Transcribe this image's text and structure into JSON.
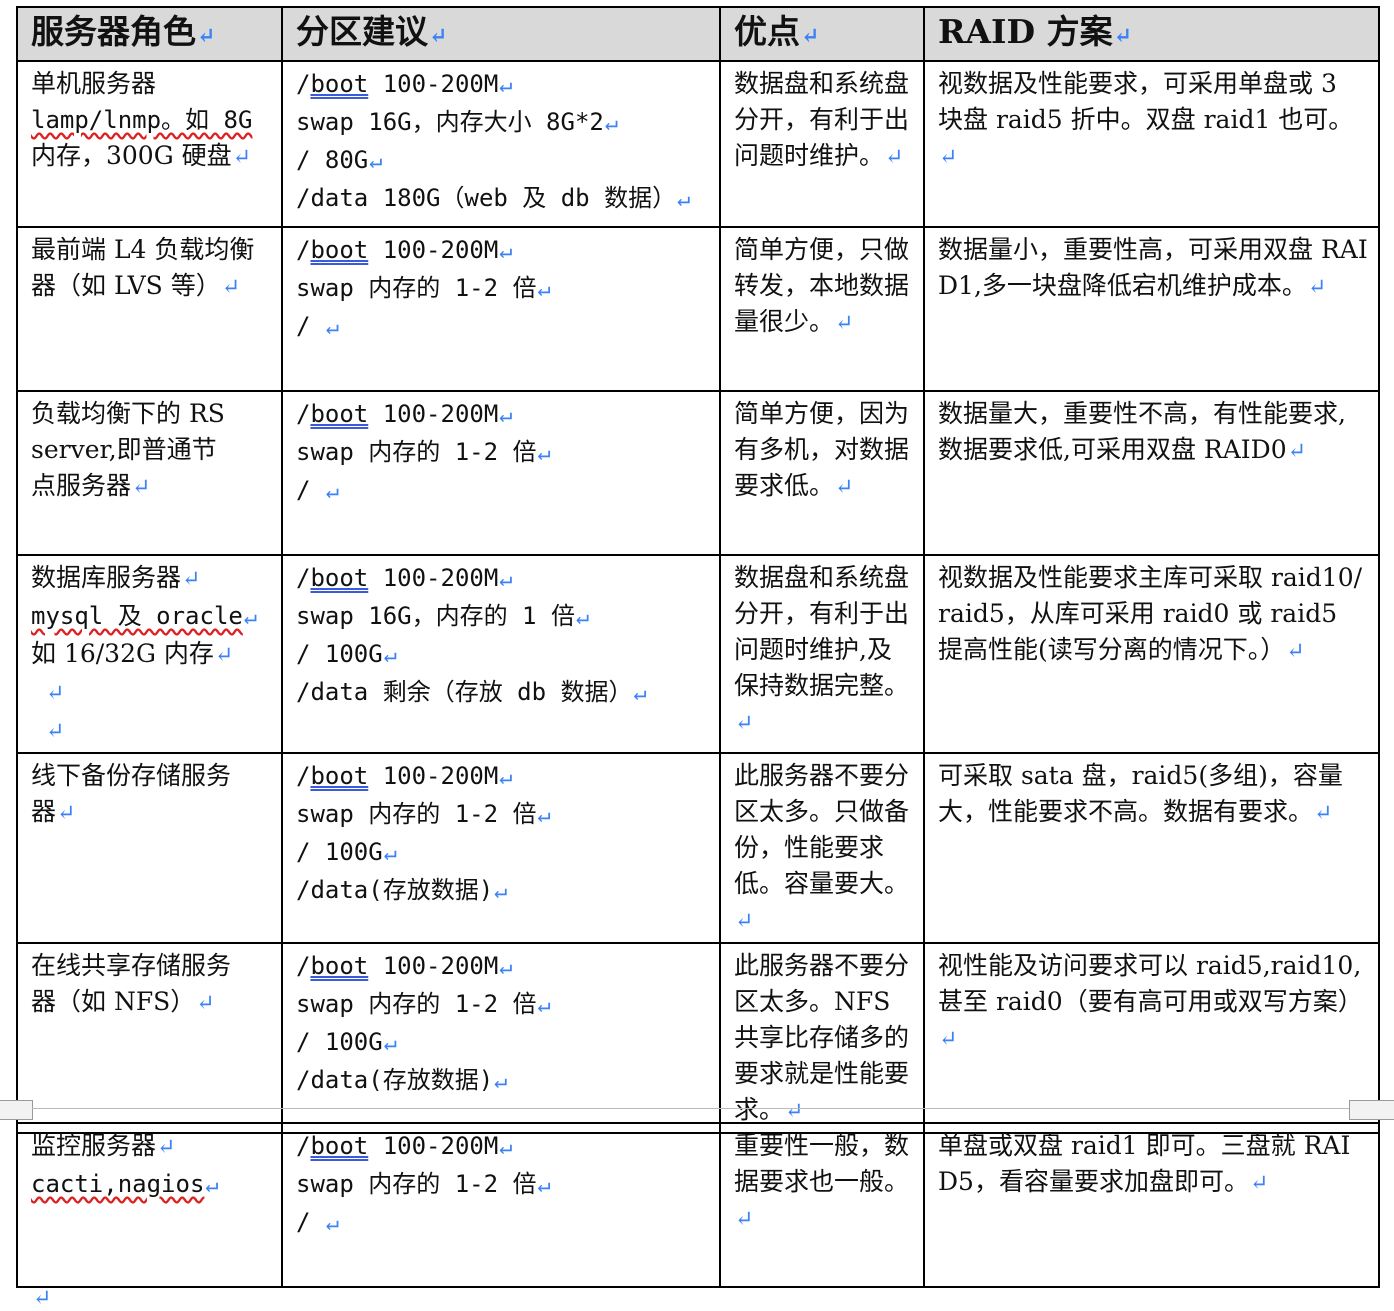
{
  "headers": [
    "服务器角色",
    "分区建议",
    "优点",
    "RAID 方案"
  ],
  "rows": [
    {
      "role": [
        "单机服务器",
        "lamp/lnmp。如 8G",
        "内存，300G 硬盘"
      ],
      "partition": [
        "/boot 100-200M",
        "swap 16G，内存大小 8G*2",
        "/ 80G",
        "/data 180G（web 及 db 数据）"
      ],
      "advantage": "数据盘和系统盘分开，有利于出问题时维护。",
      "raid": "视数据及性能要求，可采用单盘或 3 块盘 raid5 折中。双盘 raid1 也可。"
    },
    {
      "role": [
        "最前端 L4 负载均衡",
        "器（如 LVS 等）"
      ],
      "partition": [
        "/boot 100-200M",
        "swap 内存的 1-2 倍",
        "/"
      ],
      "advantage": "简单方便，只做转发，本地数据量很少。",
      "raid": "数据量小，重要性高，可采用双盘 RAID1,多一块盘降低宕机维护成本。"
    },
    {
      "role": [
        "负载均衡下的 RS",
        "server,即普通节",
        "点服务器"
      ],
      "partition": [
        "/boot 100-200M",
        "swap 内存的 1-2 倍",
        "/"
      ],
      "advantage": "简单方便，因为有多机，对数据要求低。",
      "raid": "数据量大，重要性不高，有性能要求,数据要求低,可采用双盘 RAID0"
    },
    {
      "role": [
        "数据库服务器",
        "mysql 及 oracle",
        "如 16/32G 内存",
        "",
        ""
      ],
      "partition": [
        "/boot 100-200M",
        "swap 16G，内存的 1 倍",
        "/ 100G",
        "/data 剩余（存放 db 数据）"
      ],
      "advantage": "数据盘和系统盘分开，有利于出问题时维护,及保持数据完整。",
      "raid": "视数据及性能要求主库可采取 raid10/raid5，从库可采用 raid0 或 raid5 提高性能(读写分离的情况下。）"
    },
    {
      "role": [
        "线下备份存储服务",
        "器"
      ],
      "partition": [
        "/boot 100-200M",
        "swap 内存的 1-2 倍",
        "/ 100G",
        "/data(存放数据)"
      ],
      "advantage": "此服务器不要分区太多。只做备份，性能要求低。容量要大。",
      "raid": "可采取 sata 盘，raid5(多组)，容量大，性能要求不高。数据有要求。"
    },
    {
      "role": [
        "在线共享存储服务",
        "器（如 NFS）"
      ],
      "partition": [
        "/boot 100-200M",
        "swap 内存的 1-2 倍",
        "/ 100G",
        "/data(存放数据)"
      ],
      "advantage": "此服务器不要分区太多。NFS 共享比存储多的要求就是性能要求。",
      "raid": "视性能及访问要求可以 raid5,raid10,甚至 raid0（要有高可用或双写方案）"
    }
  ],
  "last_row": {
    "role": [
      "监控服务器",
      "cacti,nagios"
    ],
    "partition": [
      "/boot 100-200M",
      "swap 内存的 1-2 倍",
      "/"
    ],
    "advantage": "重要性一般，数据要求也一般。",
    "raid": "单盘或双盘 raid1 即可。三盘就 RAID5，看容量要求加盘即可。"
  }
}
